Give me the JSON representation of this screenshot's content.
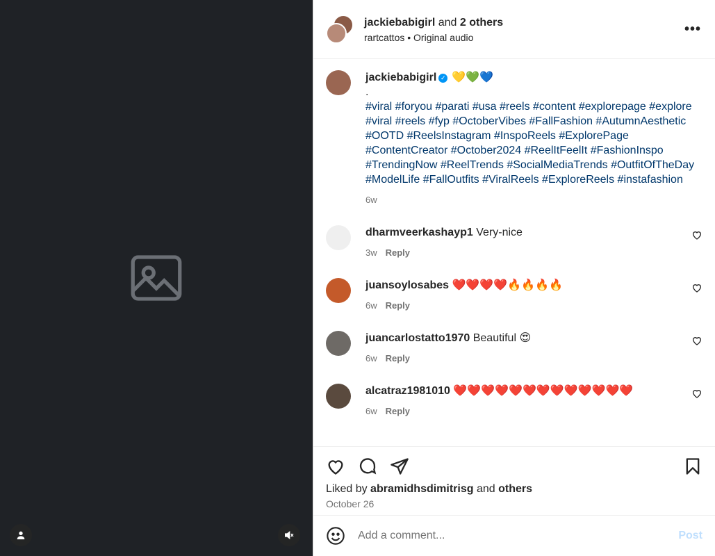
{
  "media": {
    "placeholder_icon": "image-placeholder-icon",
    "background": "#1f2226"
  },
  "header": {
    "author": "jackiebabigirl",
    "joiner": "and",
    "others": "2 others",
    "subline": "rartcattos • Original audio",
    "more_icon": "more-horizontal-icon"
  },
  "caption": {
    "username": "jackiebabigirl",
    "emojis": "💛💚💙",
    "dot": ".",
    "hashtags": "#viral #foryou #parati #usa #reels #content #explorepage #explore #viral #reels #fyp #OctoberVibes #FallFashion #AutumnAesthetic #OOTD #ReelsInstagram #InspoReels #ExplorePage #ContentCreator #October2024 #ReelItFeelIt #FashionInspo #TrendingNow #ReelTrends #SocialMediaTrends #OutfitOfTheDay #ModelLife #FallOutfits #ViralReels #ExploreReels #instafashion",
    "age": "6w"
  },
  "comments": [
    {
      "username": "dharmveerkashayp1",
      "text": "Very-nice",
      "age": "3w",
      "reply": "Reply",
      "avatar_color": "#efefef"
    },
    {
      "username": "juansoylosabes",
      "text": "❤️❤️❤️❤️🔥🔥🔥🔥",
      "age": "6w",
      "reply": "Reply",
      "avatar_color": "#c45a2a"
    },
    {
      "username": "juancarlostatto1970",
      "text": "Beautiful 😍",
      "age": "6w",
      "reply": "Reply",
      "avatar_color": "#6e6a66"
    },
    {
      "username": "alcatraz1981010",
      "text": "❤️❤️❤️❤️❤️❤️❤️❤️❤️❤️❤️❤️❤️",
      "age": "6w",
      "reply": "Reply",
      "avatar_color": "#5a4a3e"
    }
  ],
  "actions": {
    "liked_prefix": "Liked by",
    "liked_user": "abramidhsdimitrisg",
    "liked_joiner": "and",
    "liked_others": "others",
    "date": "October 26"
  },
  "composer": {
    "placeholder": "Add a comment...",
    "post_label": "Post"
  },
  "colors": {
    "link": "#00376b",
    "muted": "#737373",
    "verified": "#0095f6",
    "post_disabled": "#c0dffd"
  }
}
